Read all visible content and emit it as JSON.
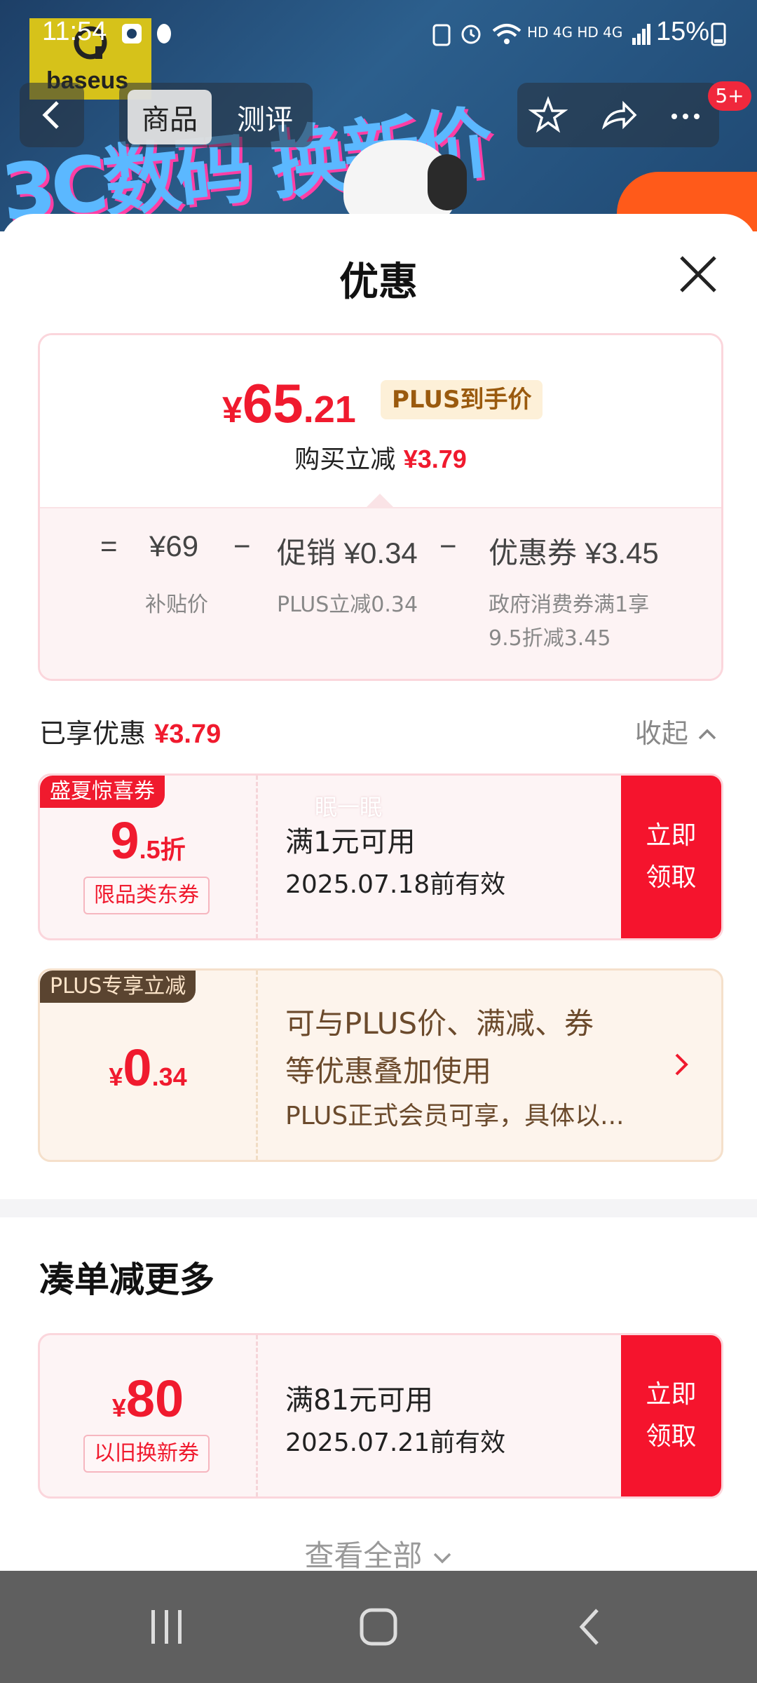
{
  "status_bar": {
    "time": "11:54",
    "network": "HD 4G HD 4G",
    "battery": "15%"
  },
  "background": {
    "logo_text": "baseus",
    "promo_text": "3C数码 换新价",
    "nav_tabs": [
      "商品",
      "测评"
    ],
    "more_badge": "5+"
  },
  "sheet": {
    "title": "优惠",
    "price": {
      "currency": "¥",
      "integer": "65",
      "decimal": ".21",
      "tag": "PLUS到手价"
    },
    "reduce": {
      "label": "购买立减",
      "amount": "¥3.79"
    },
    "breakdown": [
      {
        "op": "=",
        "label": "",
        "value": "¥69",
        "note": "补贴价"
      },
      {
        "op": "−",
        "label": "促销",
        "value": "¥0.34",
        "note": "PLUS立减0.34"
      },
      {
        "op": "−",
        "label": "优惠券",
        "value": "¥3.45",
        "note": "政府消费券满1享",
        "note2": "9.5折减3.45"
      }
    ],
    "enjoyed": {
      "label": "已享优惠",
      "amount": "¥3.79",
      "collapse": "收起"
    },
    "coupons": [
      {
        "tag": "盛夏惊喜券",
        "amount_main": "9",
        "amount_sub": ".5折",
        "pill": "限品类东券",
        "line1": "满1元可用",
        "line2": "2025.07.18前有效",
        "watermark": "眠一眠",
        "btn_line1": "立即",
        "btn_line2": "领取"
      },
      {
        "tag": "PLUS专享立减",
        "currency": "¥",
        "amount_main": "0",
        "amount_sub": ".34",
        "text1": "可与PLUS价、满减、券",
        "text2": "等优惠叠加使用",
        "text3": "PLUS正式会员可享，具体以..."
      }
    ],
    "more": {
      "title": "凑单减更多",
      "coupon": {
        "currency": "¥",
        "amount": "80",
        "pill": "以旧换新券",
        "line1": "满81元可用",
        "line2": "2025.07.21前有效",
        "btn_line1": "立即",
        "btn_line2": "领取"
      },
      "view_all": "查看全部"
    }
  },
  "colors": {
    "accent_red": "#f01a2e",
    "plus_brown": "#6b4a2c",
    "nav_bar": "#5f5f5f"
  }
}
